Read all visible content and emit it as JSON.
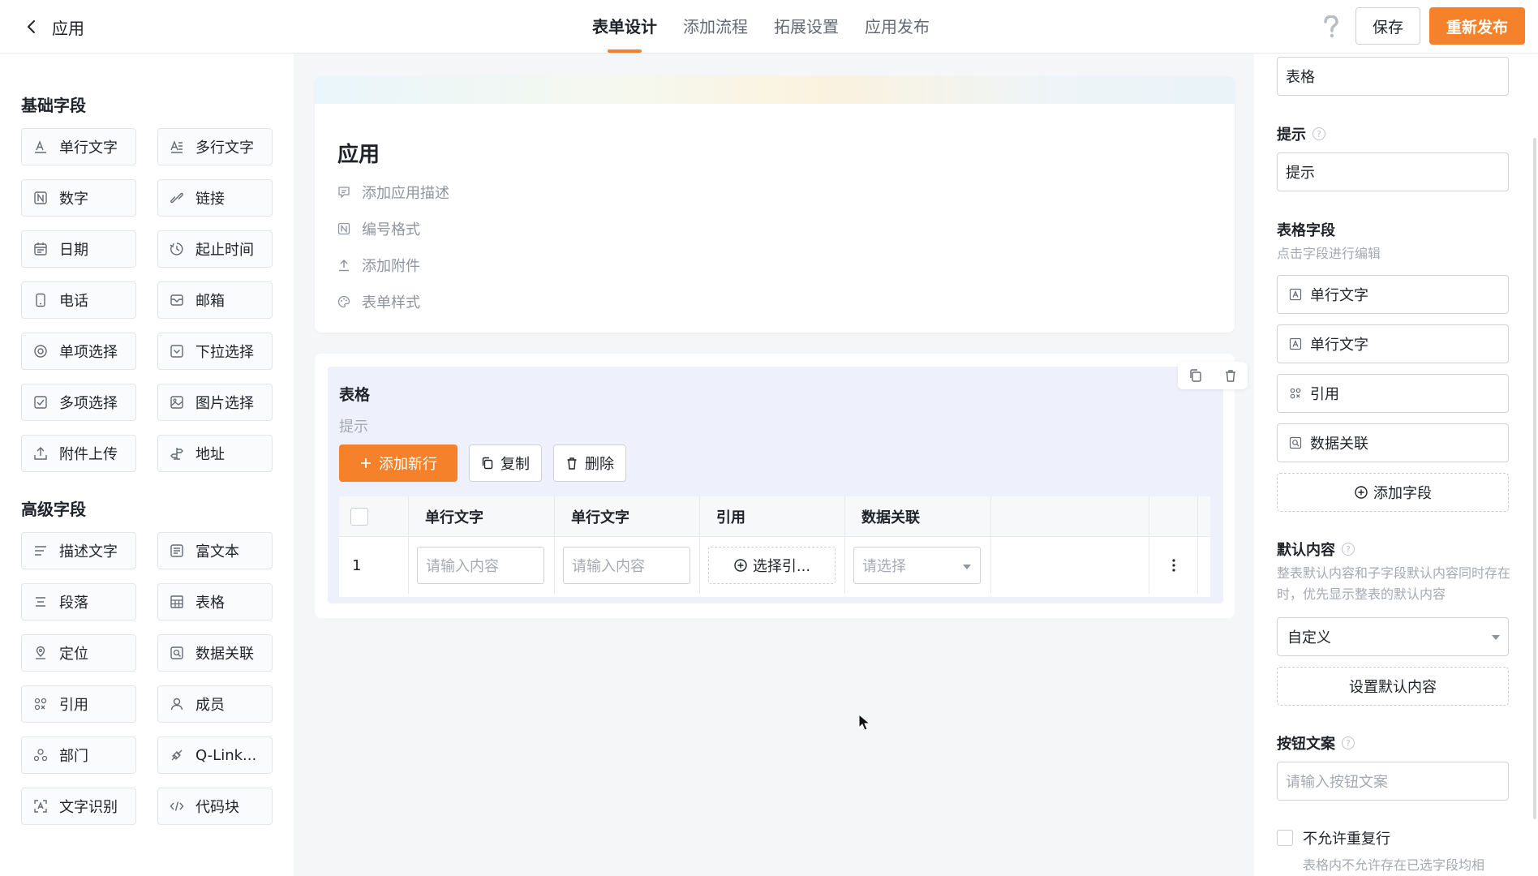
{
  "header": {
    "app_name": "应用",
    "tabs": [
      {
        "label": "表单设计",
        "active": true
      },
      {
        "label": "添加流程"
      },
      {
        "label": "拓展设置"
      },
      {
        "label": "应用发布"
      }
    ],
    "help_icon": "question-icon",
    "save_label": "保存",
    "publish_label": "重新发布",
    "accent_color": "#f5822a"
  },
  "left": {
    "basic_title": "基础字段",
    "basic_fields": [
      {
        "label": "单行文字",
        "icon": "text-a-icon"
      },
      {
        "label": "多行文字",
        "icon": "multiline-text-icon"
      },
      {
        "label": "数字",
        "icon": "number-icon"
      },
      {
        "label": "链接",
        "icon": "link-icon"
      },
      {
        "label": "日期",
        "icon": "calendar-icon"
      },
      {
        "label": "起止时间",
        "icon": "clock-range-icon"
      },
      {
        "label": "电话",
        "icon": "phone-icon"
      },
      {
        "label": "邮箱",
        "icon": "mail-icon"
      },
      {
        "label": "单项选择",
        "icon": "radio-icon"
      },
      {
        "label": "下拉选择",
        "icon": "dropdown-icon"
      },
      {
        "label": "多项选择",
        "icon": "checkbox-icon"
      },
      {
        "label": "图片选择",
        "icon": "image-icon"
      },
      {
        "label": "附件上传",
        "icon": "upload-icon"
      },
      {
        "label": "地址",
        "icon": "signpost-icon"
      }
    ],
    "advanced_title": "高级字段",
    "advanced_fields": [
      {
        "label": "描述文字",
        "icon": "description-icon"
      },
      {
        "label": "富文本",
        "icon": "rich-text-icon"
      },
      {
        "label": "段落",
        "icon": "paragraph-icon"
      },
      {
        "label": "表格",
        "icon": "table-icon"
      },
      {
        "label": "定位",
        "icon": "location-icon"
      },
      {
        "label": "数据关联",
        "icon": "data-link-icon"
      },
      {
        "label": "引用",
        "icon": "reference-icon"
      },
      {
        "label": "成员",
        "icon": "member-icon"
      },
      {
        "label": "部门",
        "icon": "department-icon"
      },
      {
        "label": "Q-Link...",
        "icon": "qlink-icon"
      },
      {
        "label": "文字识别",
        "icon": "ocr-icon"
      },
      {
        "label": "代码块",
        "icon": "code-icon"
      }
    ]
  },
  "canvas": {
    "form_title": "应用",
    "meta": [
      {
        "label": "添加应用描述",
        "icon": "comment-icon"
      },
      {
        "label": "编号格式",
        "icon": "number-format-icon"
      },
      {
        "label": "添加附件",
        "icon": "attachment-upload-icon"
      },
      {
        "label": "表单样式",
        "icon": "palette-icon"
      }
    ],
    "table": {
      "title": "表格",
      "hint": "提示",
      "add_row": "添加新行",
      "copy": "复制",
      "delete": "删除",
      "columns": [
        "单行文字",
        "单行文字",
        "引用",
        "数据关联"
      ],
      "row_index": "1",
      "text_placeholder": "请输入内容",
      "ref_label": "选择引...",
      "select_placeholder": "请选择"
    }
  },
  "right": {
    "title_value": "表格",
    "hint_label": "提示",
    "hint_value": "提示",
    "fields_label": "表格字段",
    "fields_sub": "点击字段进行编辑",
    "fields": [
      {
        "label": "单行文字",
        "icon": "text-a-icon"
      },
      {
        "label": "单行文字",
        "icon": "text-a-icon"
      },
      {
        "label": "引用",
        "icon": "reference-icon"
      },
      {
        "label": "数据关联",
        "icon": "data-link-icon"
      }
    ],
    "add_field": "添加字段",
    "default_label": "默认内容",
    "default_sub": "整表默认内容和子字段默认内容同时存在时，优先显示整表的默认内容",
    "default_select": "自定义",
    "set_default": "设置默认内容",
    "button_text_label": "按钮文案",
    "button_text_placeholder": "请输入按钮文案",
    "no_dup_label": "不允许重复行",
    "no_dup_sub": "表格内不允许存在已选字段均相"
  }
}
